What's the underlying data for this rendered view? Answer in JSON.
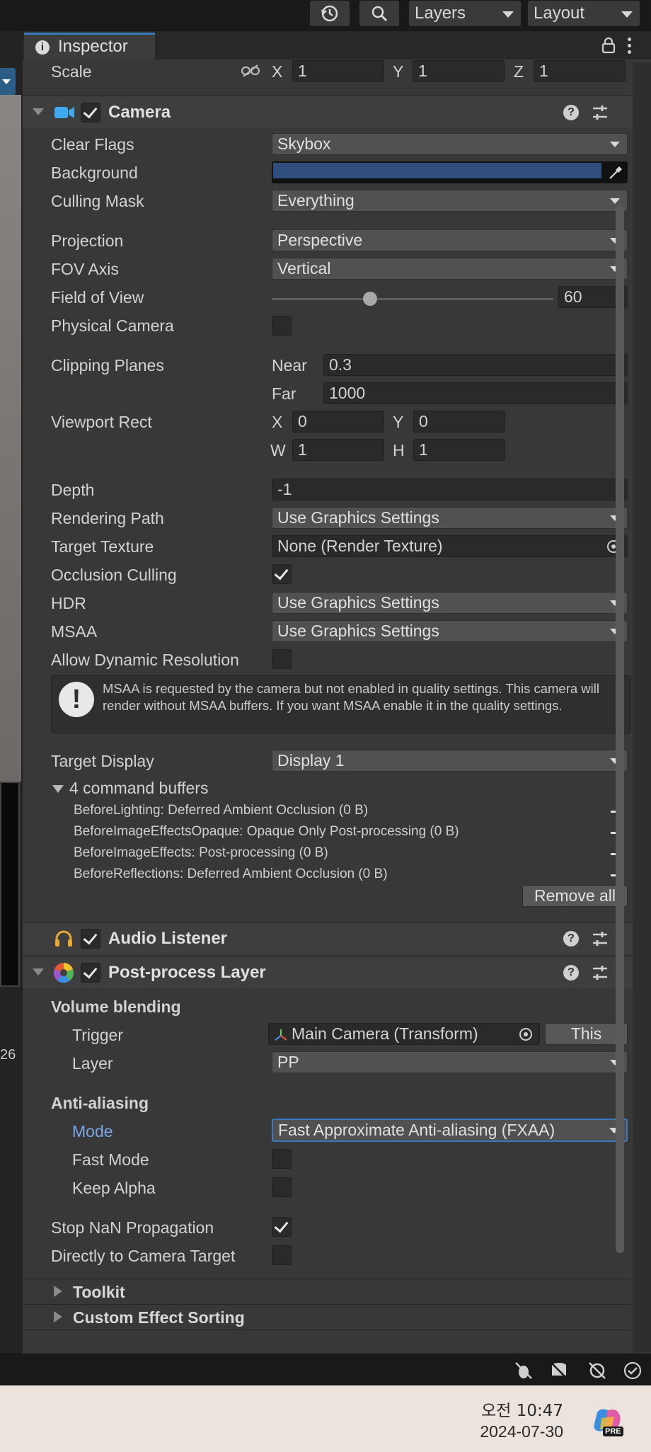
{
  "toolbar": {
    "layers_label": "Layers",
    "layout_label": "Layout"
  },
  "inspector": {
    "tab_label": "Inspector",
    "scale": {
      "label": "Scale",
      "x_label": "X",
      "x": "1",
      "y_label": "Y",
      "y": "1",
      "z_label": "Z",
      "z": "1"
    },
    "camera": {
      "title": "Camera",
      "clear_flags": {
        "label": "Clear Flags",
        "value": "Skybox"
      },
      "background": {
        "label": "Background",
        "color": "#2f4e7e"
      },
      "culling_mask": {
        "label": "Culling Mask",
        "value": "Everything"
      },
      "projection": {
        "label": "Projection",
        "value": "Perspective"
      },
      "fov_axis": {
        "label": "FOV Axis",
        "value": "Vertical"
      },
      "field_of_view": {
        "label": "Field of View",
        "value": "60",
        "fraction": 0.34
      },
      "physical_camera": {
        "label": "Physical Camera",
        "checked": false
      },
      "clipping_planes": {
        "label": "Clipping Planes",
        "near_label": "Near",
        "near": "0.3",
        "far_label": "Far",
        "far": "1000"
      },
      "viewport_rect": {
        "label": "Viewport Rect",
        "x_label": "X",
        "x": "0",
        "y_label": "Y",
        "y": "0",
        "w_label": "W",
        "w": "1",
        "h_label": "H",
        "h": "1"
      },
      "depth": {
        "label": "Depth",
        "value": "-1"
      },
      "rendering_path": {
        "label": "Rendering Path",
        "value": "Use Graphics Settings"
      },
      "target_texture": {
        "label": "Target Texture",
        "value": "None (Render Texture)"
      },
      "occlusion_culling": {
        "label": "Occlusion Culling",
        "checked": true
      },
      "hdr": {
        "label": "HDR",
        "value": "Use Graphics Settings"
      },
      "msaa": {
        "label": "MSAA",
        "value": "Use Graphics Settings"
      },
      "allow_dynamic_resolution": {
        "label": "Allow Dynamic Resolution",
        "checked": false
      },
      "warning": "MSAA is requested by the camera but not enabled in quality settings. This camera will render without MSAA buffers. If you want MSAA enable it in the quality settings.",
      "target_display": {
        "label": "Target Display",
        "value": "Display 1"
      },
      "command_buffers": {
        "header": "4 command buffers",
        "items": [
          "BeforeLighting: Deferred Ambient Occlusion (0 B)",
          "BeforeImageEffectsOpaque: Opaque Only Post-processing (0 B)",
          "BeforeImageEffects: Post-processing (0 B)",
          "BeforeReflections: Deferred Ambient Occlusion (0 B)"
        ],
        "remove_all": "Remove all"
      }
    },
    "audio_listener": {
      "title": "Audio Listener"
    },
    "post_process_layer": {
      "title": "Post-process Layer",
      "volume_blending": "Volume blending",
      "trigger": {
        "label": "Trigger",
        "value": "Main Camera (Transform)",
        "this_button": "This"
      },
      "layer": {
        "label": "Layer",
        "value": "PP"
      },
      "anti_aliasing": "Anti-aliasing",
      "mode": {
        "label": "Mode",
        "value": "Fast Approximate Anti-aliasing (FXAA)"
      },
      "fast_mode": {
        "label": "Fast Mode",
        "checked": false
      },
      "keep_alpha": {
        "label": "Keep Alpha",
        "checked": false
      },
      "stop_nan": {
        "label": "Stop NaN Propagation",
        "checked": true
      },
      "directly_to_camera": {
        "label": "Directly to Camera Target",
        "checked": false
      },
      "toolkit": "Toolkit",
      "custom_effect_sorting": "Custom Effect Sorting"
    }
  },
  "left_strip": {
    "number": "26"
  },
  "taskbar": {
    "time": "오전 10:47",
    "date": "2024-07-30",
    "badge": "PRE"
  },
  "colors": {
    "accent": "#3a79bb",
    "panel": "#383838",
    "field": "#2a2a2a",
    "mode_label": "#7ba6e6"
  }
}
